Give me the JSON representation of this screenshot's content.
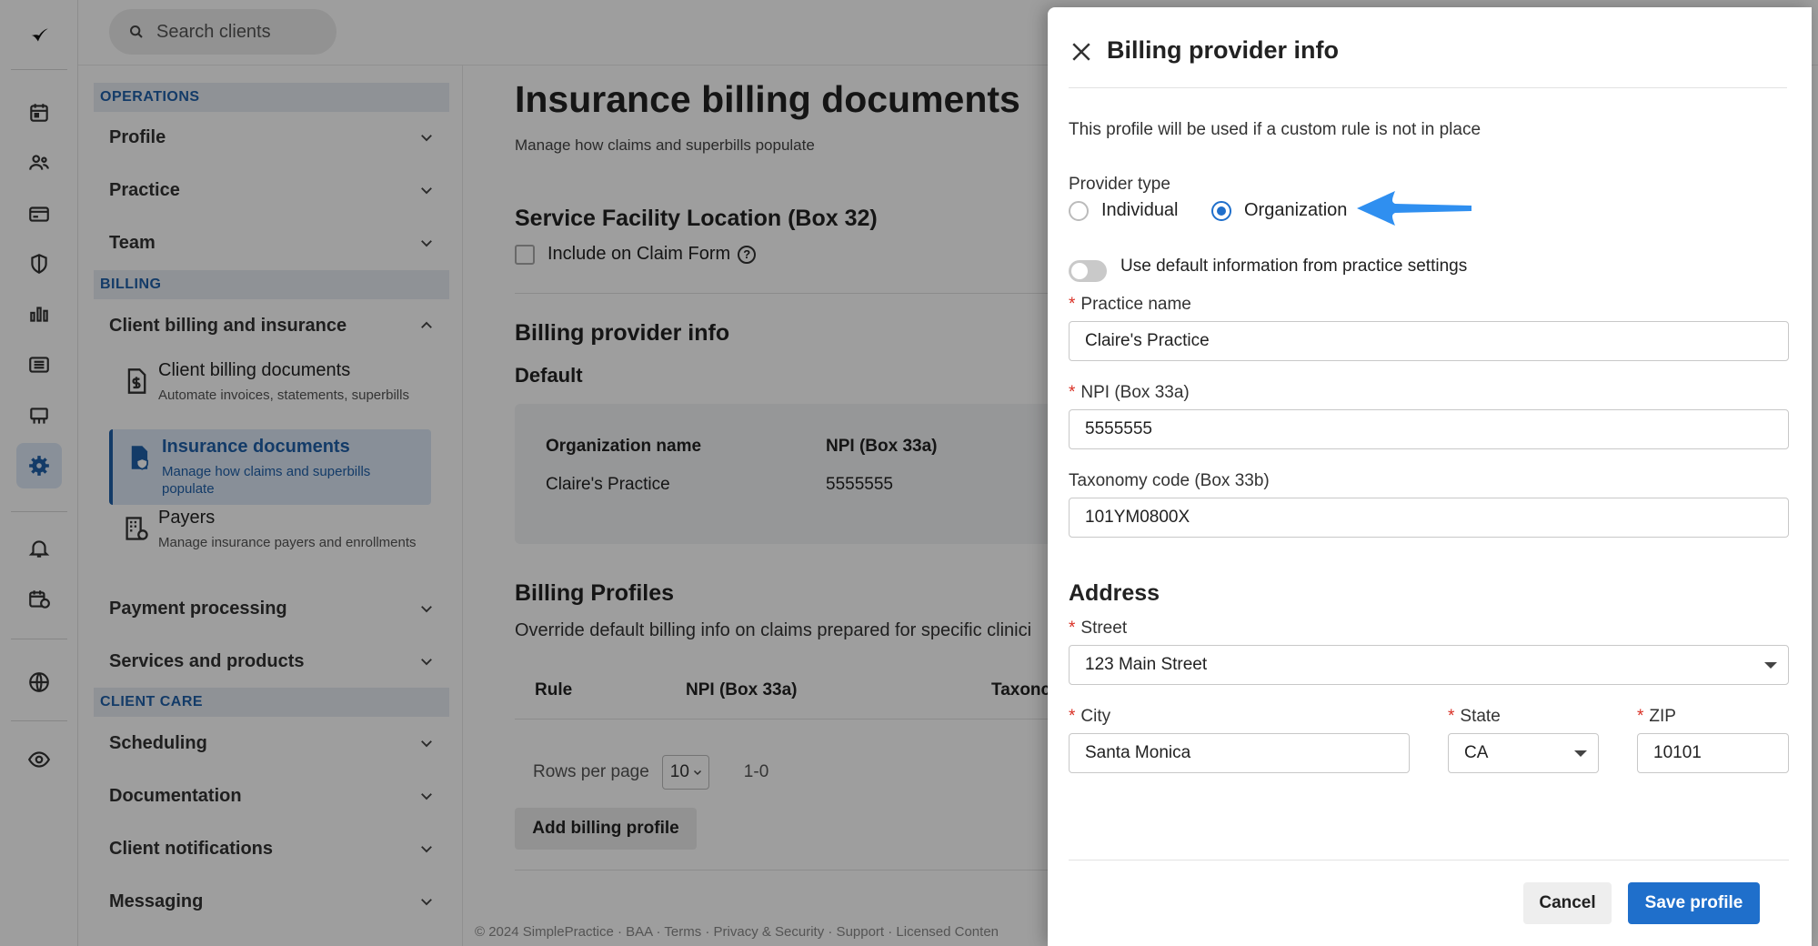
{
  "search": {
    "placeholder": "Search clients"
  },
  "sidebar": {
    "sections": [
      {
        "label": "OPERATIONS"
      },
      {
        "label": "BILLING"
      },
      {
        "label": "CLIENT CARE"
      }
    ],
    "items": {
      "profile": "Profile",
      "practice": "Practice",
      "team": "Team",
      "client_billing": "Client billing and insurance",
      "payment_processing": "Payment processing",
      "services_products": "Services and products",
      "scheduling": "Scheduling",
      "documentation": "Documentation",
      "client_notifications": "Client notifications",
      "messaging": "Messaging"
    },
    "subitems": [
      {
        "title": "Client billing documents",
        "desc": "Automate invoices, statements, superbills"
      },
      {
        "title": "Insurance documents",
        "desc": "Manage how claims and superbills populate"
      },
      {
        "title": "Payers",
        "desc": "Manage insurance payers and enrollments"
      }
    ]
  },
  "main": {
    "title": "Insurance billing documents",
    "subtitle": "Manage how claims and superbills populate",
    "service_facility_title": "Service Facility Location (Box 32)",
    "include_on_claim": "Include on Claim Form",
    "help_glyph": "?",
    "billing_provider_title": "Billing provider info",
    "default_label": "Default",
    "org_name_label": "Organization name",
    "org_name_value": "Claire's Practice",
    "npi_label": "NPI (Box 33a)",
    "npi_value": "5555555",
    "billing_profiles_title": "Billing Profiles",
    "billing_profiles_desc": "Override default billing info on claims prepared for specific clinici",
    "table_headers": {
      "rule": "Rule",
      "npi": "NPI (Box 33a)",
      "taxonomy": "Taxonc"
    },
    "rows_per_page_label": "Rows per page",
    "rows_per_page_value": "10",
    "page_range": "1-0",
    "add_billing_profile": "Add billing profile",
    "footer": "© 2024 SimplePractice · BAA · Terms · Privacy & Security · Support · Licensed Conten"
  },
  "drawer": {
    "title": "Billing provider info",
    "note": "This profile will be used if a custom rule is not in place",
    "provider_type_label": "Provider type",
    "provider_type_options": [
      "Individual",
      "Organization"
    ],
    "provider_type_selected": "Organization",
    "use_default_label": "Use default information from practice settings",
    "use_default_on": false,
    "required_mark": "*",
    "practice_name_label": "Practice name",
    "practice_name_value": "Claire's Practice",
    "npi_label": "NPI (Box 33a)",
    "npi_value": "5555555",
    "taxonomy_label": "Taxonomy code (Box 33b)",
    "taxonomy_value": "101YM0800X",
    "address_title": "Address",
    "street_label": "Street",
    "street_value": "123 Main Street",
    "city_label": "City",
    "city_value": "Santa Monica",
    "state_label": "State",
    "state_value": "CA",
    "zip_label": "ZIP",
    "zip_value": "10101",
    "cancel_label": "Cancel",
    "save_label": "Save profile"
  },
  "colors": {
    "accent": "#1f6fcb",
    "required": "#d93025",
    "annotation_arrow": "#2f8ff0"
  }
}
